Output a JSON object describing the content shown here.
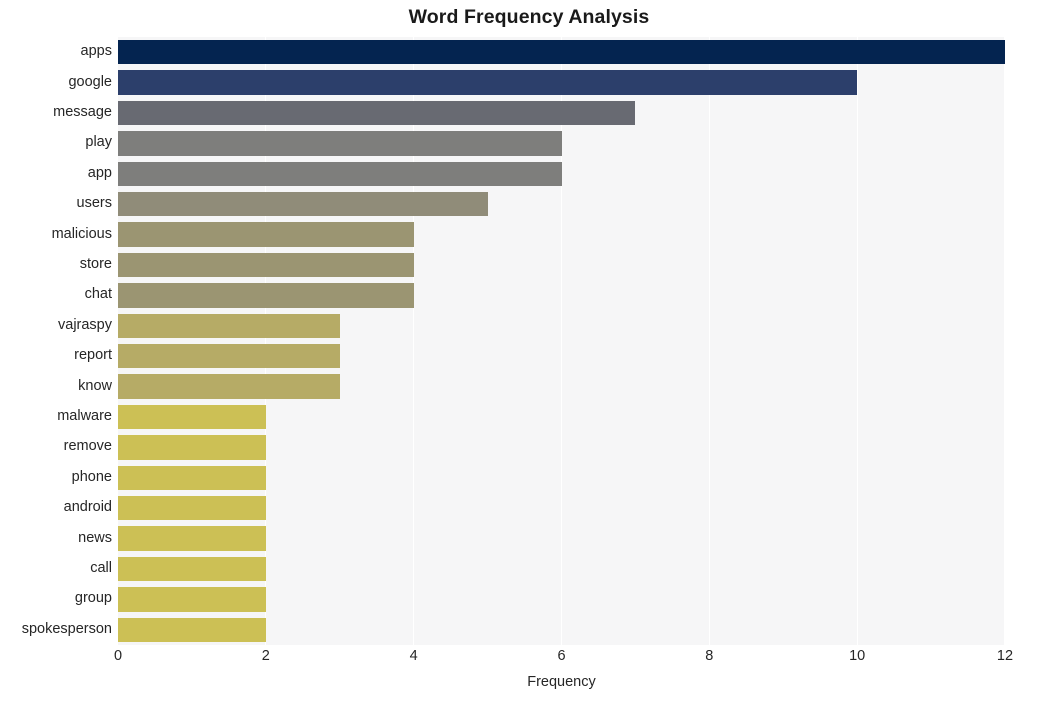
{
  "chart_data": {
    "type": "bar",
    "orientation": "horizontal",
    "title": "Word Frequency Analysis",
    "xlabel": "Frequency",
    "ylabel": "",
    "categories": [
      "apps",
      "google",
      "message",
      "play",
      "app",
      "users",
      "malicious",
      "store",
      "chat",
      "vajraspy",
      "report",
      "know",
      "malware",
      "remove",
      "phone",
      "android",
      "news",
      "call",
      "group",
      "spokesperson"
    ],
    "values": [
      12,
      10,
      7,
      6,
      6,
      5,
      4,
      4,
      4,
      3,
      3,
      3,
      2,
      2,
      2,
      2,
      2,
      2,
      2,
      2
    ],
    "xticks": [
      0,
      2,
      4,
      6,
      8,
      10,
      12
    ],
    "xtick_labels": [
      "0",
      "2",
      "4",
      "6",
      "8",
      "10",
      "12"
    ],
    "xlim": [
      0,
      12
    ],
    "grid": true,
    "grid_axis": "x",
    "legend": false,
    "bar_colors": [
      "#042450",
      "#2c3f6b",
      "#686a72",
      "#7e7e7c",
      "#7e7e7c",
      "#908c79",
      "#9b9572",
      "#9b9572",
      "#9b9572",
      "#b6ab66",
      "#b6ab66",
      "#b6ab66",
      "#ccc055",
      "#ccc055",
      "#ccc055",
      "#ccc055",
      "#ccc055",
      "#ccc055",
      "#ccc055",
      "#ccc055"
    ],
    "plot_bg": "#f6f6f7",
    "grid_color": "#ffffff",
    "figure_bg": "#ffffff",
    "text_color": "#262626",
    "title_color": "#1a1a1a"
  }
}
